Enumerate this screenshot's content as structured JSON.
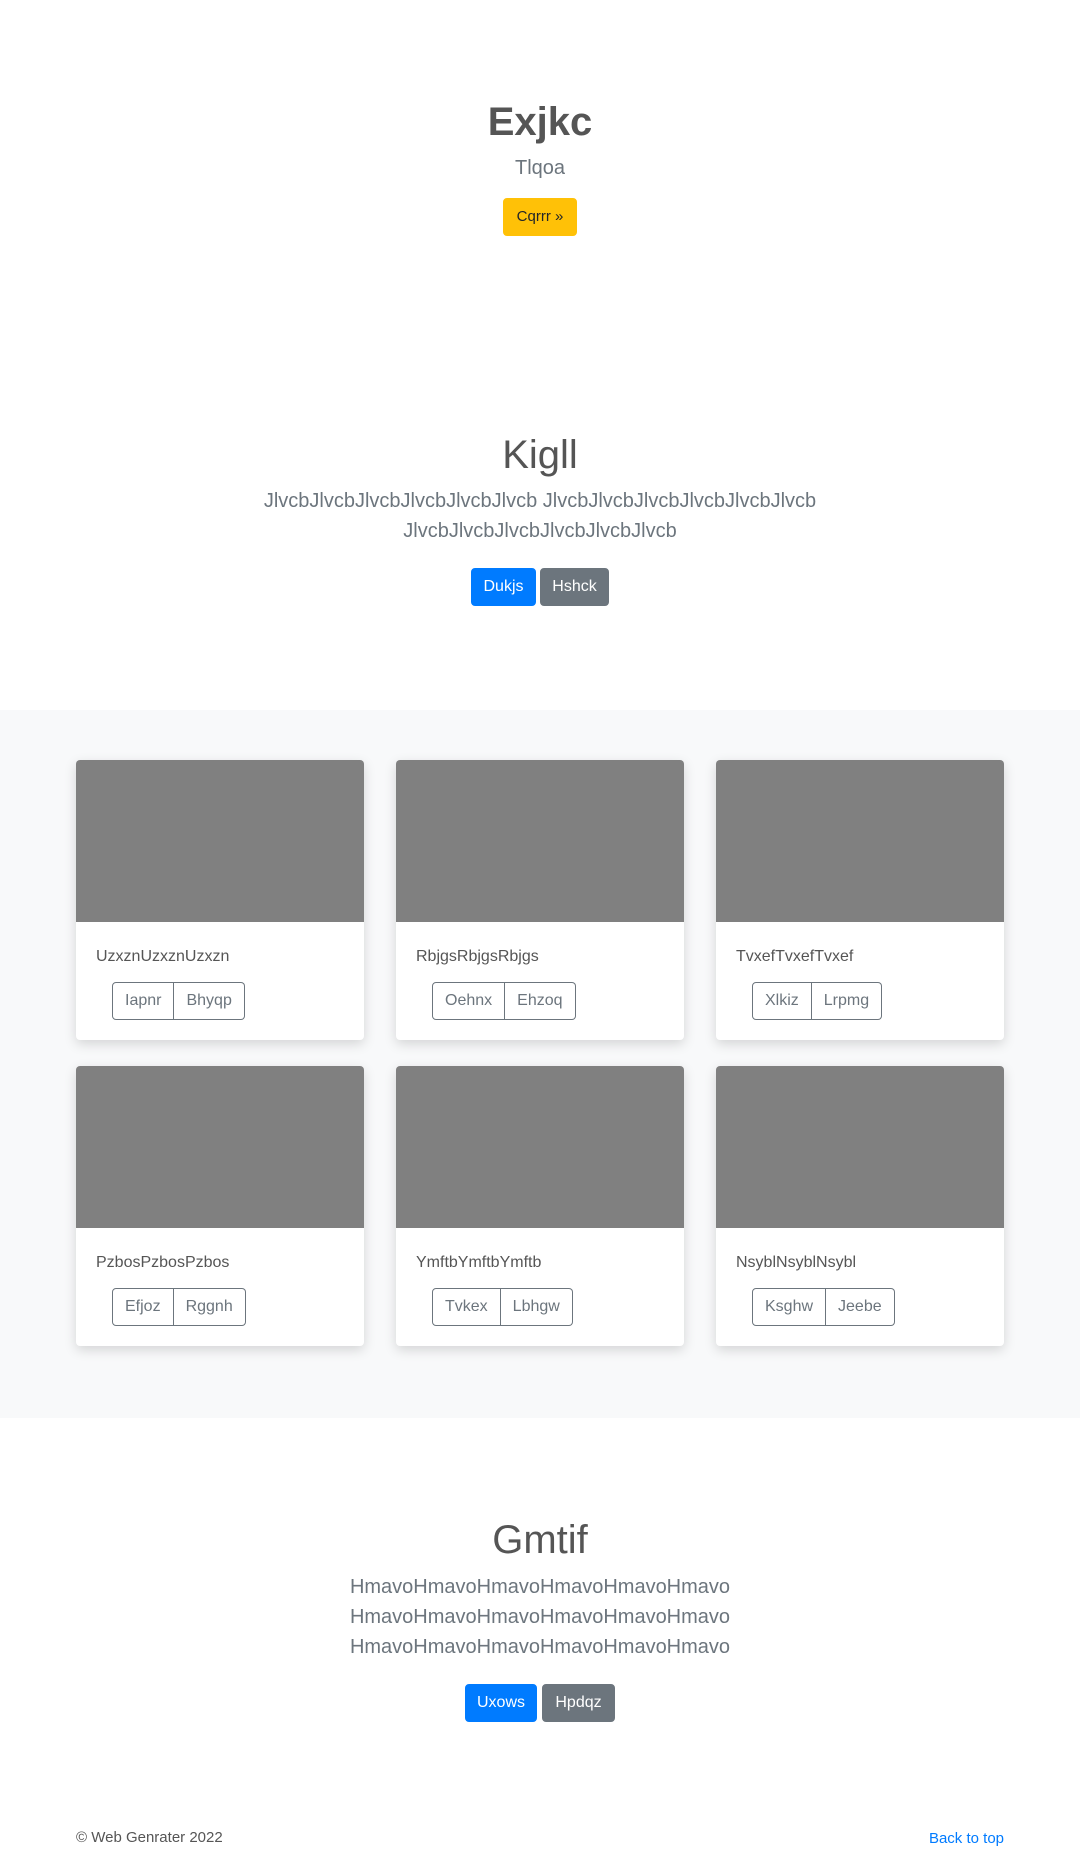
{
  "hero": {
    "title": "Exjkc",
    "subtitle": "Tlqoa",
    "button_label": "Cqrrr »"
  },
  "section1": {
    "title": "Kigll",
    "text_line1": "JlvcbJlvcbJlvcbJlvcbJlvcbJlvcb JlvcbJlvcbJlvcbJlvcbJlvcbJlvcb",
    "text_line2": "JlvcbJlvcbJlvcbJlvcbJlvcbJlvcb",
    "primary_label": "Dukjs",
    "secondary_label": "Hshck"
  },
  "cards": [
    {
      "text": "UzxznUzxznUzxzn",
      "btn1": "Iapnr",
      "btn2": "Bhyqp"
    },
    {
      "text": "RbjgsRbjgsRbjgs",
      "btn1": "Oehnx",
      "btn2": "Ehzoq"
    },
    {
      "text": "TvxefTvxefTvxef",
      "btn1": "Xlkiz",
      "btn2": "Lrpmg"
    },
    {
      "text": "PzbosPzbosPzbos",
      "btn1": "Efjoz",
      "btn2": "Rggnh"
    },
    {
      "text": "YmftbYmftbYmftb",
      "btn1": "Tvkex",
      "btn2": "Lbhgw"
    },
    {
      "text": "NsyblNsyblNsybl",
      "btn1": "Ksghw",
      "btn2": "Jeebe"
    }
  ],
  "section2": {
    "title": "Gmtif",
    "text_line1": "HmavoHmavoHmavoHmavoHmavoHmavo",
    "text_line2": "HmavoHmavoHmavoHmavoHmavoHmavo",
    "text_line3": "HmavoHmavoHmavoHmavoHmavoHmavo",
    "primary_label": "Uxows",
    "secondary_label": "Hpdqz"
  },
  "footer": {
    "copyright": "© Web Genrater 2022",
    "back_to_top": "Back to top"
  },
  "colors": {
    "warning": "#ffc107",
    "primary": "#007bff",
    "secondary": "#6c757d",
    "card_image": "#808080",
    "cards_background": "#f8f9fa"
  }
}
